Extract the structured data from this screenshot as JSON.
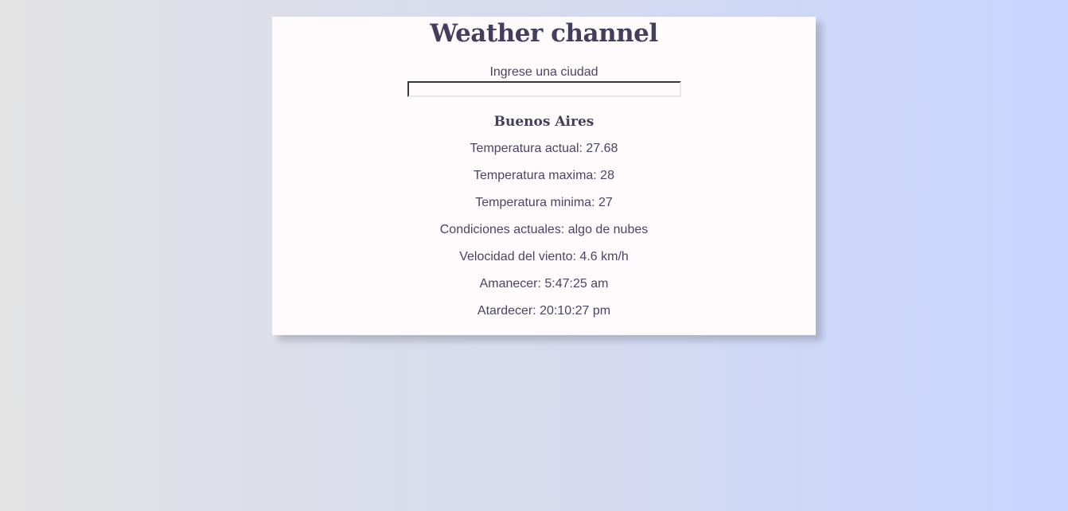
{
  "app": {
    "title": "Weather channel"
  },
  "search": {
    "label": "Ingrese una ciudad",
    "value": "",
    "placeholder": ""
  },
  "weather": {
    "city": "Buenos Aires",
    "rows": [
      "Temperatura actual: 27.68",
      "Temperatura maxima: 28",
      "Temperatura minima: 27",
      "Condiciones actuales: algo de nubes",
      "Velocidad del viento: 4.6 km/h",
      "Amanecer: 5:47:25 am",
      "Atardecer: 20:10:27 pm"
    ]
  },
  "colors": {
    "background_start": "#e3e3e3",
    "background_end": "#c7d5ff",
    "card": "#fffafb",
    "text": "#4a4463",
    "heading": "#433d5e"
  }
}
